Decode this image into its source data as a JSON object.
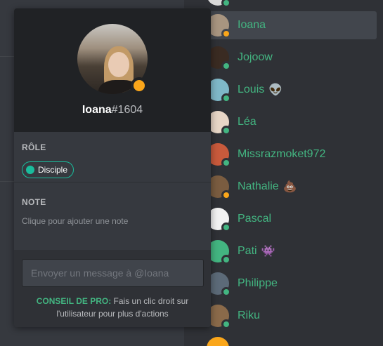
{
  "colors": {
    "online": "#43b581",
    "idle": "#faa61a",
    "role": "#1abc9c"
  },
  "profile": {
    "username": "Ioana",
    "discriminator": "#1604",
    "status": "idle",
    "role_section_title": "RÔLE",
    "role_name": "Disciple",
    "note_section_title": "NOTE",
    "note_placeholder": "Clique pour ajouter une note",
    "message_placeholder": "Envoyer un message à @Ioana",
    "protip_label": "CONSEIL DE PRO:",
    "protip_text": " Fais un clic droit sur l'utilisateur pour plus d'actions"
  },
  "members": [
    {
      "name": "Ioana",
      "status": "idle",
      "emoji": "",
      "selected": true,
      "avatar_color": "#a89580"
    },
    {
      "name": "Jojoow",
      "status": "online",
      "emoji": "",
      "selected": false,
      "avatar_color": "#3a2b22"
    },
    {
      "name": "Louis",
      "status": "online",
      "emoji": "👽",
      "selected": false,
      "avatar_color": "#7fb8c8"
    },
    {
      "name": "Léa",
      "status": "online",
      "emoji": "",
      "selected": false,
      "avatar_color": "#e7d6c6"
    },
    {
      "name": "Missrazmoket972",
      "status": "online",
      "emoji": "",
      "selected": false,
      "avatar_color": "#c85a3c"
    },
    {
      "name": "Nathalie",
      "status": "idle",
      "emoji": "💩",
      "selected": false,
      "avatar_color": "#7a5c40"
    },
    {
      "name": "Pascal",
      "status": "online",
      "emoji": "",
      "selected": false,
      "avatar_color": "#f2f2f2"
    },
    {
      "name": "Pati",
      "status": "online",
      "emoji": "👾",
      "selected": false,
      "avatar_color": "#43b581"
    },
    {
      "name": "Philippe",
      "status": "online",
      "emoji": "",
      "selected": false,
      "avatar_color": "#5c6a78"
    },
    {
      "name": "Riku",
      "status": "online",
      "emoji": "",
      "selected": false,
      "avatar_color": "#8a6a4a"
    }
  ]
}
